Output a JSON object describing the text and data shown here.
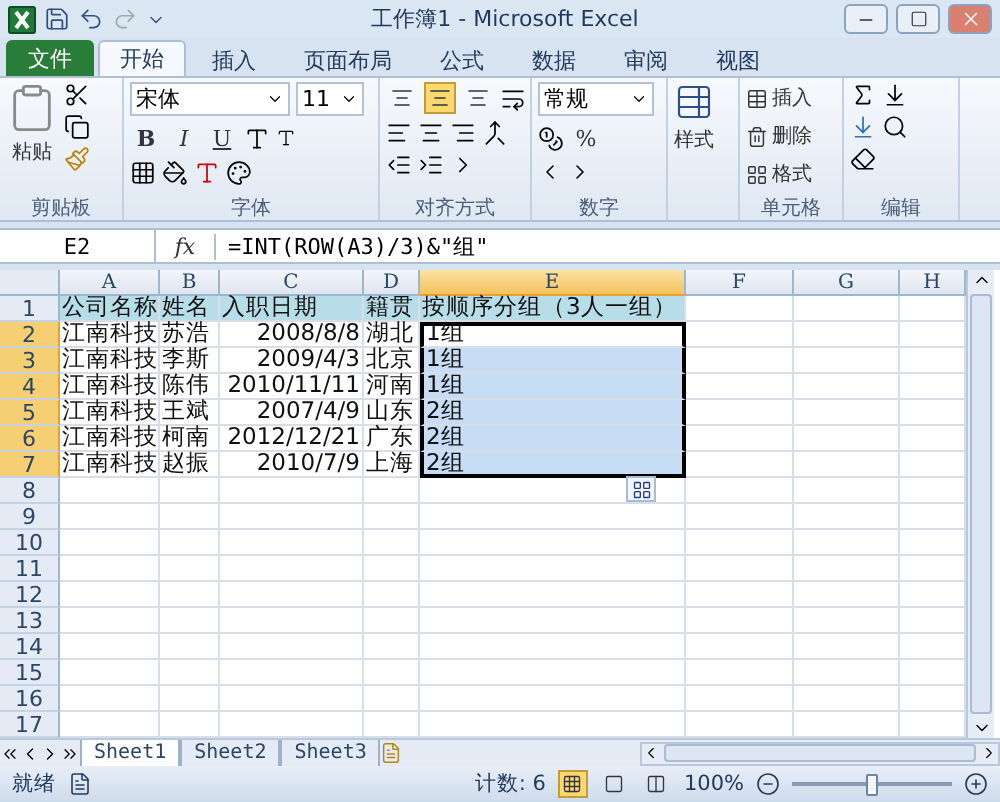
{
  "window": {
    "title": "工作簿1 - Microsoft Excel"
  },
  "tabs": [
    {
      "label": "文件",
      "kind": "file",
      "selected": false
    },
    {
      "label": "开始",
      "kind": "tab",
      "selected": true
    },
    {
      "label": "插入",
      "kind": "tab",
      "selected": false
    },
    {
      "label": "页面布局",
      "kind": "tab",
      "selected": false
    },
    {
      "label": "公式",
      "kind": "tab",
      "selected": false
    },
    {
      "label": "数据",
      "kind": "tab",
      "selected": false
    },
    {
      "label": "审阅",
      "kind": "tab",
      "selected": false
    },
    {
      "label": "视图",
      "kind": "tab",
      "selected": false
    }
  ],
  "ribbon": {
    "clipboard": {
      "label": "剪贴板",
      "paste": "粘贴"
    },
    "font": {
      "label": "字体",
      "font_name": "宋体",
      "font_size": "11",
      "bold": "B",
      "italic": "I",
      "underline": "U"
    },
    "alignment": {
      "label": "对齐方式",
      "vertical_align": [
        {
          "selected": false
        },
        {
          "selected": true
        },
        {
          "selected": false
        }
      ]
    },
    "number": {
      "label": "数字",
      "format": "常规",
      "percent": "%"
    },
    "styles": {
      "label": "样式"
    },
    "cells": {
      "label": "单元格",
      "items": [
        "插入",
        "删除",
        "格式"
      ]
    },
    "editing": {
      "label": "编辑"
    }
  },
  "formula_bar": {
    "name_box": "E2",
    "function_label": "fx",
    "formula": "=INT(ROW(A3)/3)&\"组\""
  },
  "sheet": {
    "columns": [
      {
        "label": "A",
        "selected": false
      },
      {
        "label": "B",
        "selected": false
      },
      {
        "label": "C",
        "selected": false
      },
      {
        "label": "D",
        "selected": false
      },
      {
        "label": "E",
        "selected": true
      },
      {
        "label": "F",
        "selected": false
      },
      {
        "label": "G",
        "selected": false
      },
      {
        "label": "H",
        "selected": false
      }
    ],
    "rows": [
      {
        "number": "1",
        "selected": false,
        "header": true,
        "cells": [
          "公司名称",
          "姓名",
          "入职日期",
          "籍贯",
          "按顺序分组（3人一组）"
        ]
      },
      {
        "number": "2",
        "selected": true,
        "header": false,
        "active": true,
        "cells": [
          "江南科技",
          "苏浩",
          "2008/8/8",
          "湖北",
          "1组"
        ]
      },
      {
        "number": "3",
        "selected": true,
        "header": false,
        "active": false,
        "cells": [
          "江南科技",
          "李斯",
          "2009/4/3",
          "北京",
          "1组"
        ]
      },
      {
        "number": "4",
        "selected": true,
        "header": false,
        "active": false,
        "cells": [
          "江南科技",
          "陈伟",
          "2010/11/11",
          "河南",
          "1组"
        ]
      },
      {
        "number": "5",
        "selected": true,
        "header": false,
        "active": false,
        "cells": [
          "江南科技",
          "王斌",
          "2007/4/9",
          "山东",
          "2组"
        ]
      },
      {
        "number": "6",
        "selected": true,
        "header": false,
        "active": false,
        "cells": [
          "江南科技",
          "柯南",
          "2012/12/21",
          "广东",
          "2组"
        ]
      },
      {
        "number": "7",
        "selected": true,
        "header": false,
        "active": false,
        "cells": [
          "江南科技",
          "赵振",
          "2010/7/9",
          "上海",
          "2组"
        ]
      },
      {
        "number": "8",
        "selected": false
      },
      {
        "number": "9",
        "selected": false
      },
      {
        "number": "10",
        "selected": false
      },
      {
        "number": "11",
        "selected": false
      },
      {
        "number": "12",
        "selected": false
      },
      {
        "number": "13",
        "selected": false
      },
      {
        "number": "14",
        "selected": false
      },
      {
        "number": "15",
        "selected": false
      },
      {
        "number": "16",
        "selected": false
      },
      {
        "number": "17",
        "selected": false
      }
    ]
  },
  "sheet_tabs": [
    {
      "label": "Sheet1",
      "selected": true
    },
    {
      "label": "Sheet2",
      "selected": false
    },
    {
      "label": "Sheet3",
      "selected": false
    }
  ],
  "status_bar": {
    "ready": "就绪",
    "count": "计数: 6",
    "views": [
      {
        "selected": true
      },
      {
        "selected": false
      },
      {
        "selected": false
      }
    ],
    "zoom": "100%",
    "level": 0.5
  }
}
